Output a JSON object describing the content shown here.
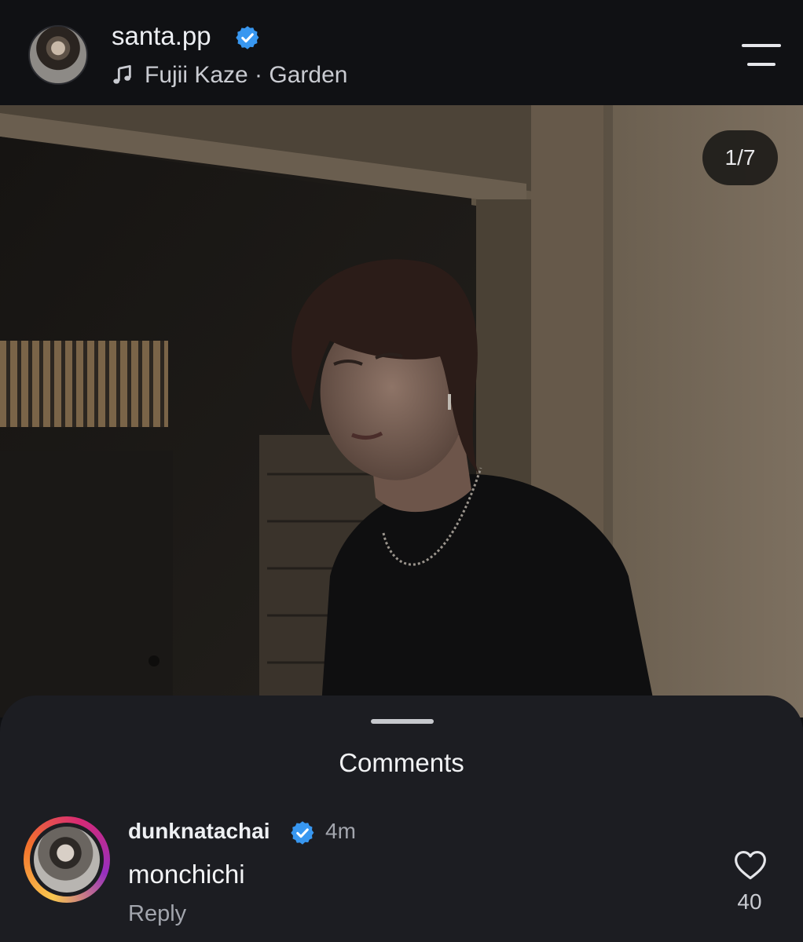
{
  "post": {
    "username": "santa.pp",
    "verified": true,
    "music": "Fujii Kaze · Garden",
    "photo_counter": "1/7",
    "profile_icon": "avatar",
    "menu_icon": "menu-icon"
  },
  "comments": {
    "title": "Comments",
    "items": [
      {
        "username": "dunknatachai",
        "verified": true,
        "time": "4m",
        "text": "monchichi",
        "reply_label": "Reply",
        "likes": "40"
      }
    ]
  },
  "colors": {
    "verified_blue": "#3897f0",
    "story_ring": [
      "#f9c74f",
      "#f3722c",
      "#d62976",
      "#962fbf"
    ]
  }
}
